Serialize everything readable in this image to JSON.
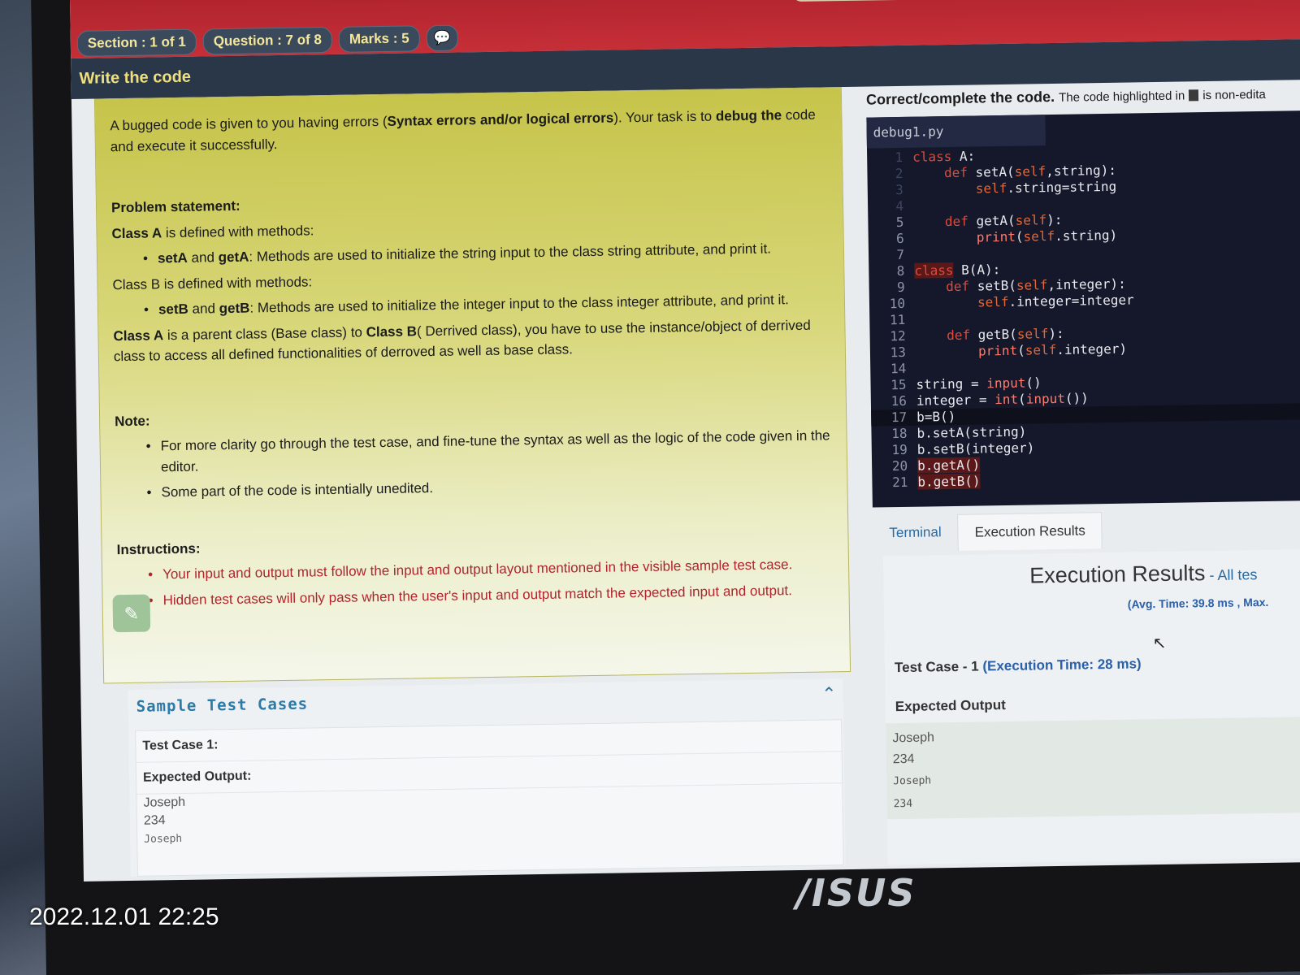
{
  "header": {
    "section": "Section : 1 of 1",
    "question": "Question : 7 of 8",
    "marks": "Marks : 5",
    "chat_icon": "chat-icon"
  },
  "subheader": {
    "title": "Write the code"
  },
  "problem": {
    "intro_pre": "A bugged code is given to you having errors (",
    "intro_bold1": "Syntax errors and/or logical errors",
    "intro_mid": "). Your task is to ",
    "intro_bold2": "debug the",
    "intro_end": "code and execute it successfully.",
    "statement_label": "Problem statement",
    "classA_bold": "Class A",
    "classA_rest": " is defined with methods:",
    "classA_bullet_bold": "setA",
    "classA_bullet_and": " and ",
    "classA_bullet_bold2": "getA",
    "classA_bullet_rest": ": Methods are used to initialize the string input to the class string attribute, and print it.",
    "classB_line": "Class B is defined with methods:",
    "classB_bullet_bold": "setB",
    "classB_bullet_and": " and ",
    "classB_bullet_bold2": "getB",
    "classB_bullet_rest": ": Methods are used to initialize the integer input to the class integer attribute, and print it.",
    "parent_bold1": "Class A",
    "parent_mid": " is a parent class (Base class) to ",
    "parent_bold2": "Class B",
    "parent_rest": "( Derrived class), you have to use the instance/object of derrived class to access all defined functionalities of derroved as well as base class.",
    "note_label": "Note:",
    "notes": [
      "For more clarity go through the test case, and fine-tune the syntax as well as the logic of the code given in the editor.",
      "Some part of the code is intentially unedited."
    ],
    "instructions_label": "Instructions",
    "instructions": [
      "Your input and output must follow the input and output layout mentioned in the visible sample test case.",
      "Hidden test cases will only pass when the user's input and output match the expected input and output."
    ],
    "pencil_icon": "pencil-icon"
  },
  "sample": {
    "title": "Sample Test Cases",
    "collapse_icon": "chevron-up-icon",
    "test_case": "Test Case 1:",
    "expected_label": "Expected Output:",
    "outputs": [
      "Joseph",
      "234"
    ],
    "output_mono": "Joseph"
  },
  "editor": {
    "heading_bold": "Correct/complete the code.",
    "heading_note_pre": "The code highlighted in",
    "heading_note_post": "is non-edita",
    "filename": "debug1.py",
    "lines": [
      {
        "n": "1",
        "dim": true,
        "html": "<span class=\"kw\">class</span> A:"
      },
      {
        "n": "2",
        "dim": true,
        "html": "    <span class=\"kw\">def</span> setA(<span class=\"sf\">self</span>,string):"
      },
      {
        "n": "3",
        "dim": true,
        "html": "        <span class=\"sf\">self</span>.string=string"
      },
      {
        "n": "4",
        "dim": true,
        "html": ""
      },
      {
        "n": "5",
        "dim": false,
        "html": "    <span class=\"kw\">def</span> getA(<span class=\"sf\">self</span>):"
      },
      {
        "n": "6",
        "dim": false,
        "html": "        <span class=\"fn-r\">print</span>(<span class=\"sf\">self</span>.string)"
      },
      {
        "n": "7",
        "dim": false,
        "html": ""
      },
      {
        "n": "8",
        "dim": false,
        "html": "<span class=\"kw hl-red\">class</span> B(A):"
      },
      {
        "n": "9",
        "dim": false,
        "html": "    <span class=\"kw\">def</span> setB(<span class=\"sf\">self</span>,integer):"
      },
      {
        "n": "10",
        "dim": false,
        "html": "        <span class=\"sf\">self</span>.integer=integer"
      },
      {
        "n": "11",
        "dim": false,
        "html": ""
      },
      {
        "n": "12",
        "dim": false,
        "html": "    <span class=\"kw\">def</span> getB(<span class=\"sf\">self</span>):"
      },
      {
        "n": "13",
        "dim": false,
        "html": "        <span class=\"fn-r\">print</span>(<span class=\"sf\">self</span>.integer)"
      },
      {
        "n": "14",
        "dim": false,
        "html": ""
      },
      {
        "n": "15",
        "dim": false,
        "html": "string = <span class=\"fn-r\">input</span>()"
      },
      {
        "n": "16",
        "dim": false,
        "html": "integer = <span class=\"fn-r\">int</span>(<span class=\"fn-r\">input</span>())"
      },
      {
        "n": "17",
        "dim": false,
        "active": true,
        "html": "b=B()"
      },
      {
        "n": "18",
        "dim": false,
        "html": "b.setA(string)"
      },
      {
        "n": "19",
        "dim": false,
        "html": "b.setB(integer)"
      },
      {
        "n": "20",
        "dim": false,
        "html": "<span class=\"hl-red\">b.getA()</span>"
      },
      {
        "n": "21",
        "dim": false,
        "html": "<span class=\"hl-red\">b.getB()</span>"
      }
    ]
  },
  "tabs": [
    "Terminal",
    "Execution Results"
  ],
  "results": {
    "title": "Execution Results",
    "title_suffix": " - All tes",
    "avg": "(Avg. Time: 39.8 ms , Max.",
    "cursor_icon": "mouse-cursor-icon",
    "test_case_label": "Test Case - 1",
    "test_case_time": "(Execution Time: 28 ms)",
    "expected_label": "Expected Output",
    "outputs": [
      "Joseph",
      "234"
    ],
    "outputs_mono": [
      "Joseph",
      "234"
    ]
  },
  "device": {
    "brand": "/ISUS",
    "timestamp": "2022.12.01 22:25"
  }
}
